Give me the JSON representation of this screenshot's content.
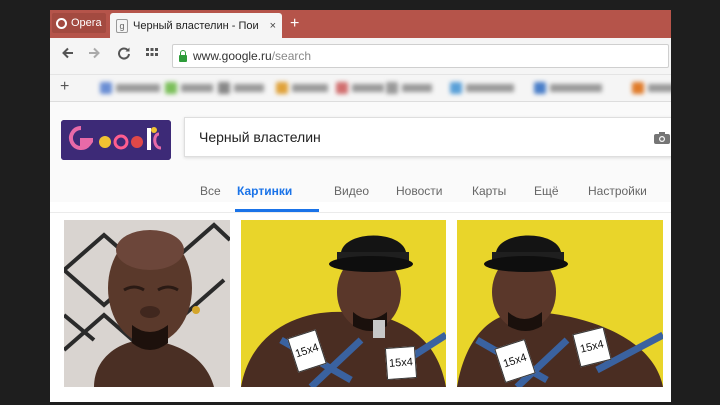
{
  "browser": {
    "menu_label": "Opera",
    "tab": {
      "favicon_letter": "g",
      "title": "Черный властелин - Пои",
      "close_glyph": "×"
    },
    "new_tab_glyph": "+",
    "address": {
      "host": "www.google.ru",
      "path": "/search"
    },
    "bookmarks_add_glyph": "+"
  },
  "search": {
    "query": "Черный властелин",
    "tabs": [
      {
        "label": "Все"
      },
      {
        "label": "Картинки",
        "active": true
      },
      {
        "label": "Видео"
      },
      {
        "label": "Новости"
      },
      {
        "label": "Карты"
      },
      {
        "label": "Ещё"
      },
      {
        "label": "Настройки"
      }
    ]
  },
  "results": {
    "images": [
      {
        "caption": ""
      },
      {
        "stickers": [
          "15x4",
          "15x4"
        ]
      },
      {
        "stickers": [
          "15x4",
          "15x4"
        ]
      }
    ]
  },
  "colors": {
    "titlebar": "#b5544a",
    "accent": "#1a73e8",
    "photo_yellow": "#e9d52a"
  }
}
